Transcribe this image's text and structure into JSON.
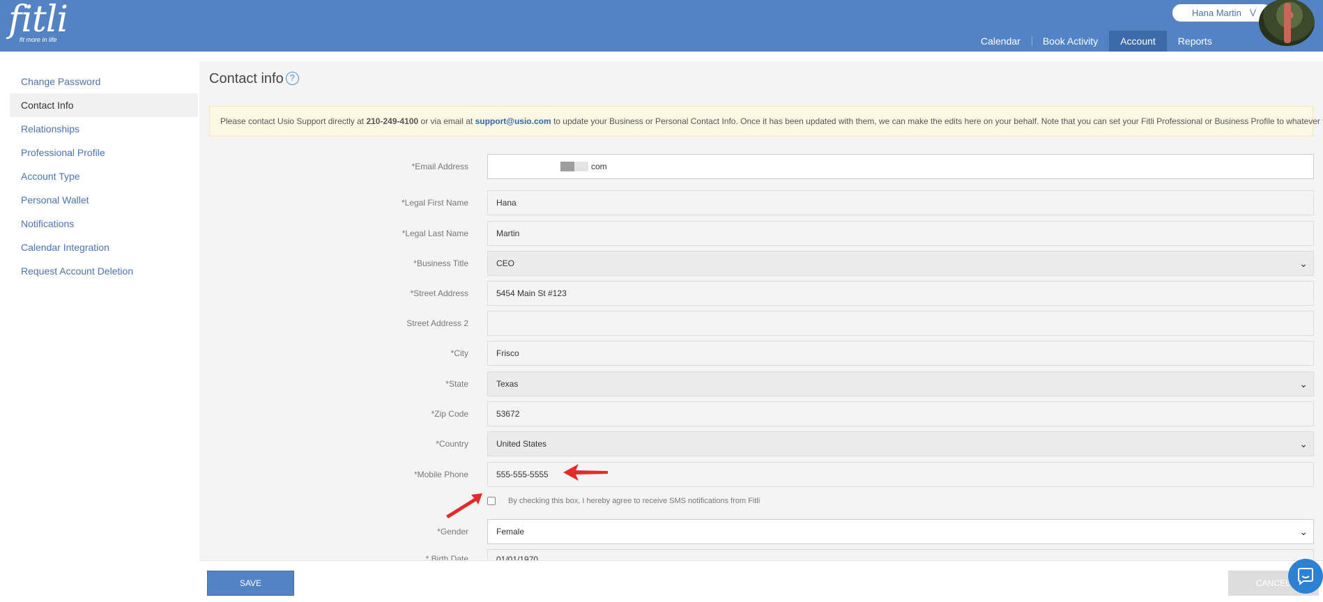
{
  "brand": {
    "logo_text": "fitli",
    "tagline": "fit more in life"
  },
  "user": {
    "name": "Hana Martin"
  },
  "nav": [
    {
      "label": "Calendar"
    },
    {
      "label": "Book Activity"
    },
    {
      "label": "Account"
    },
    {
      "label": "Reports"
    }
  ],
  "sidebar": {
    "items": [
      {
        "label": "Change Password"
      },
      {
        "label": "Contact Info"
      },
      {
        "label": "Relationships"
      },
      {
        "label": "Professional Profile"
      },
      {
        "label": "Account Type"
      },
      {
        "label": "Personal Wallet"
      },
      {
        "label": "Notifications"
      },
      {
        "label": "Calendar Integration"
      },
      {
        "label": "Request Account Deletion"
      }
    ]
  },
  "page": {
    "title": "Contact info",
    "help": "?"
  },
  "notice": {
    "prefix": "Please contact Usio Support directly at",
    "phone": "210-249-4100",
    "middle": "or via email at",
    "email": "support@usio.com",
    "suffix": "to update your Business or Personal Contact Info. Once it has been updated with them, we can make the edits here on your behalf. Note that you can set your Fitli Professional or Business Profile to whatever you like."
  },
  "form": {
    "email": {
      "label": "*Email Address",
      "value_suffix": "com"
    },
    "first_name": {
      "label": "*Legal First Name",
      "value": "Hana"
    },
    "last_name": {
      "label": "*Legal Last Name",
      "value": "Martin"
    },
    "business_title": {
      "label": "*Business Title",
      "value": "CEO"
    },
    "street": {
      "label": "*Street Address",
      "value": "5454 Main St #123"
    },
    "street2": {
      "label": "Street Address 2",
      "value": ""
    },
    "city": {
      "label": "*City",
      "value": "Frisco"
    },
    "state": {
      "label": "*State",
      "value": "Texas"
    },
    "zip": {
      "label": "*Zip Code",
      "value": "53672"
    },
    "country": {
      "label": "*Country",
      "value": "United States"
    },
    "mobile": {
      "label": "*Mobile Phone",
      "value": "555-555-5555"
    },
    "sms_consent": {
      "label": "By checking this box, I hereby agree to receive SMS notifications from Fitli",
      "checked": false
    },
    "gender": {
      "label": "*Gender",
      "value": "Female"
    },
    "birth_date": {
      "label": "* Birth Date",
      "value": "01/01/1970"
    }
  },
  "footer": {
    "save_label": "SAVE",
    "cancel_label": "CANCEL"
  },
  "colors": {
    "brand": "#5383c3",
    "nav_active": "#3d6aa8",
    "notice_bg": "#fcf8e3",
    "annotation_arrow": "#e32b2b"
  }
}
